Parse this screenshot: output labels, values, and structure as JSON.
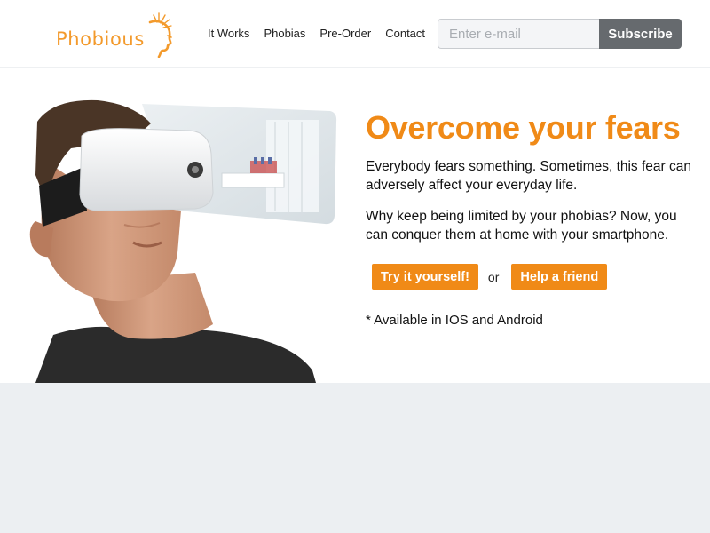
{
  "brand": {
    "name": "Phobious",
    "color": "#f39a2c",
    "logo_icon": "head-profile-sunburst-icon"
  },
  "nav": {
    "items": [
      {
        "label": "It Works"
      },
      {
        "label": "Phobias"
      },
      {
        "label": "Pre-Order"
      },
      {
        "label": "Contact"
      }
    ]
  },
  "subscribe": {
    "placeholder": "Enter e-mail",
    "value": "",
    "button_label": "Subscribe",
    "button_color": "#666a6e"
  },
  "hero": {
    "image_icon": "man-wearing-vr-headset-photo",
    "title": "Overcome your fears",
    "paragraph_1": "Everybody fears something. Sometimes, this fear can adversely affect your everyday life.",
    "paragraph_2": "Why keep being limited by your phobias? Now, you can conquer them at home with your smartphone.",
    "cta_primary": "Try it yourself!",
    "cta_separator": "or",
    "cta_secondary": "Help a friend",
    "availability": "* Available in IOS and Android",
    "accent_color": "#f08a17"
  },
  "lower_band": {
    "background": "#eceff2"
  }
}
